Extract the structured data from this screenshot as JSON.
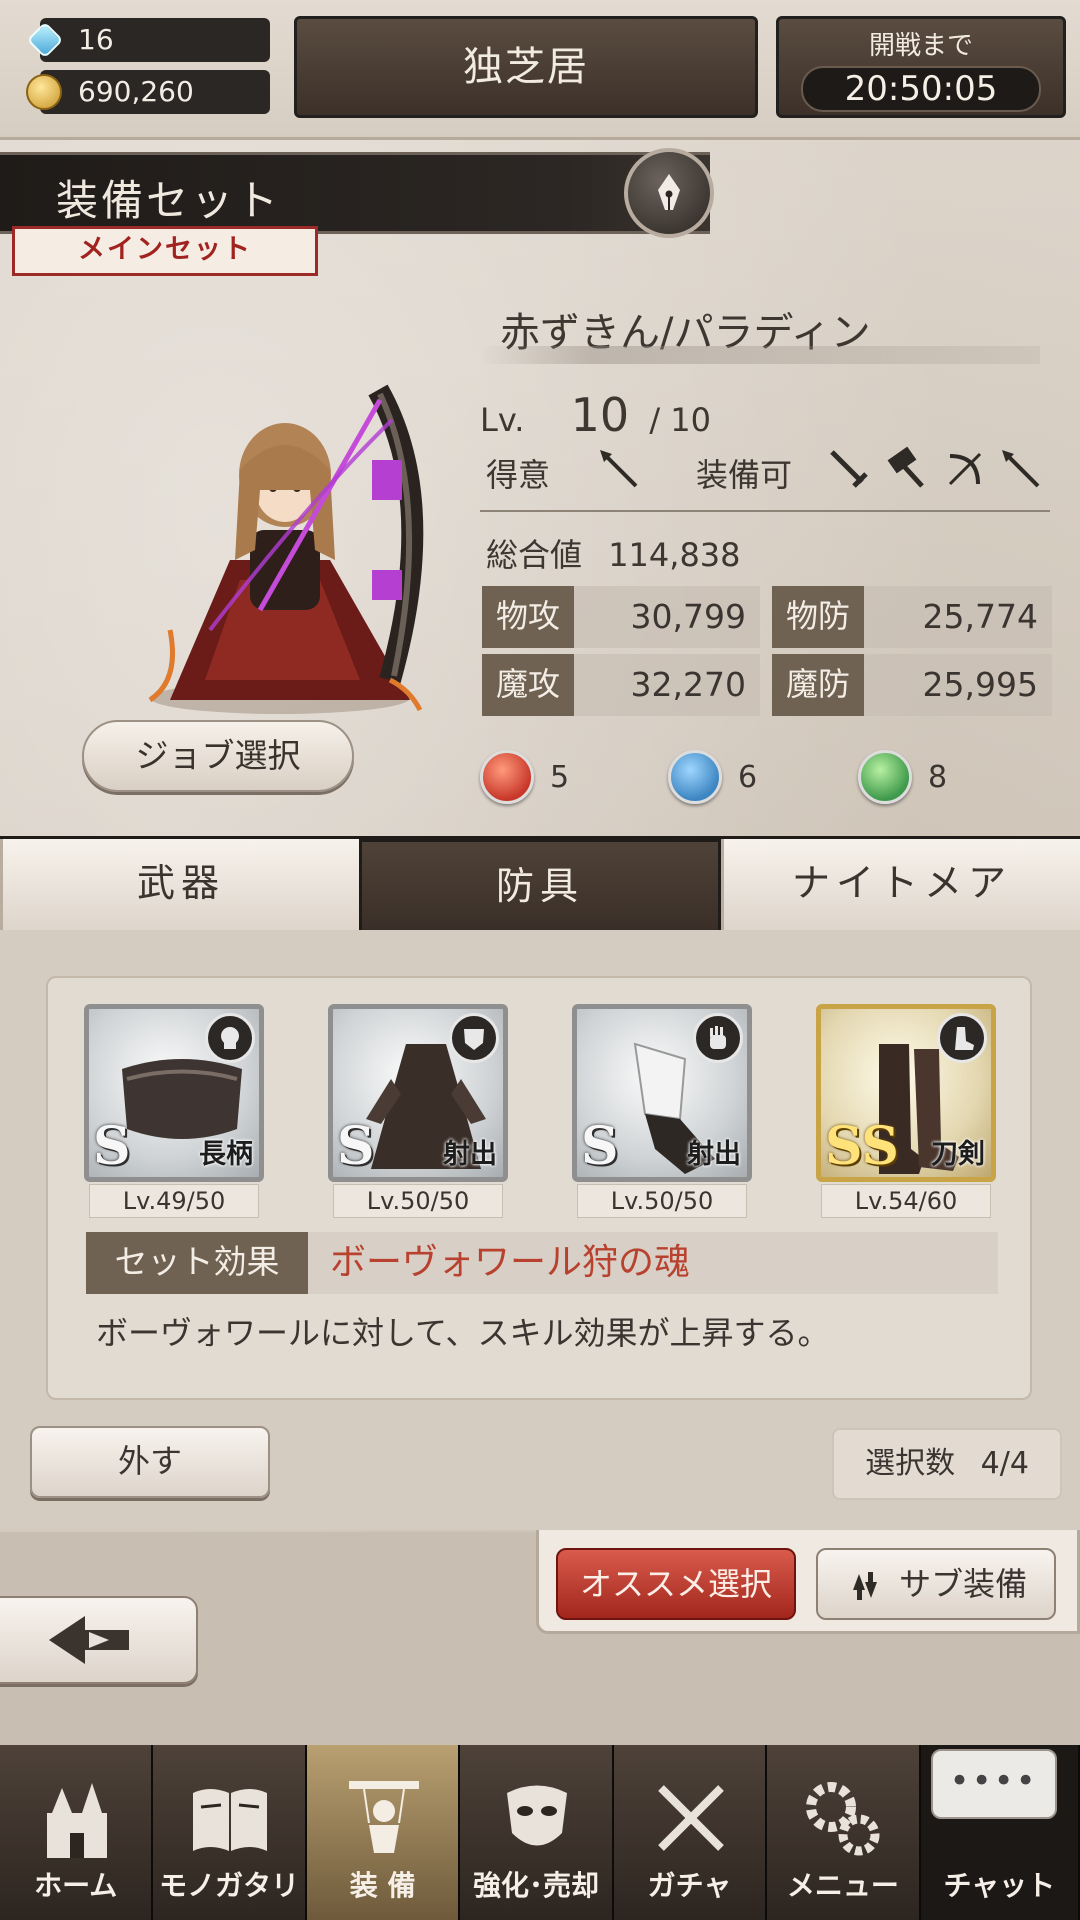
{
  "topbar": {
    "crystals": "16",
    "coins": "690,260",
    "title": "独芝居",
    "timer_label": "開戦まで",
    "timer_value": "20:50:05"
  },
  "equip_set": {
    "title": "装備セット",
    "ribbon": "メインセット"
  },
  "character": {
    "job_name": "赤ずきん/パラディン",
    "level_label": "Lv.",
    "level": "10",
    "level_max": "/ 10",
    "specialty_label": "得意",
    "equippable_label": "装備可",
    "total_label": "総合値",
    "total_value": "114,838",
    "stats": [
      {
        "label": "物攻",
        "value": "30,799"
      },
      {
        "label": "物防",
        "value": "25,774"
      },
      {
        "label": "魔攻",
        "value": "32,270"
      },
      {
        "label": "魔防",
        "value": "25,995"
      }
    ],
    "elements": [
      {
        "name": "fire",
        "count": "5",
        "color": "#c8382a"
      },
      {
        "name": "water",
        "count": "6",
        "color": "#3d86c2"
      },
      {
        "name": "wind",
        "count": "8",
        "color": "#3f9a4b"
      }
    ],
    "job_select_label": "ジョブ選択"
  },
  "tabs": [
    {
      "label": "武器",
      "active": false
    },
    {
      "label": "防具",
      "active": true
    },
    {
      "label": "ナイトメア",
      "active": false
    }
  ],
  "slots": [
    {
      "rank": "S",
      "type": "長柄",
      "level": "Lv.49/50",
      "badge_icon": "head-icon"
    },
    {
      "rank": "S",
      "type": "射出",
      "level": "Lv.50/50",
      "badge_icon": "body-icon"
    },
    {
      "rank": "S",
      "type": "射出",
      "level": "Lv.50/50",
      "badge_icon": "hand-icon"
    },
    {
      "rank": "SS",
      "type": "刀剣",
      "level": "Lv.54/60",
      "badge_icon": "foot-icon"
    }
  ],
  "set_effect": {
    "label": "セット効果",
    "name": "ボーヴォワール狩の魂",
    "description": "ボーヴォワールに対して、スキル効果が上昇する。"
  },
  "actions": {
    "remove_label": "外す",
    "count_label": "選択数",
    "count_value": "4/4",
    "recommend_label": "オススメ選択",
    "sub_label": "サブ装備"
  },
  "nav": [
    {
      "label": "ホーム",
      "icon": "castle-icon",
      "active": false
    },
    {
      "label": "モノガタリ",
      "icon": "book-icon",
      "active": false
    },
    {
      "label": "装 備",
      "icon": "puppet-icon",
      "active": true
    },
    {
      "label": "強化･売却",
      "icon": "mask-icon",
      "active": false
    },
    {
      "label": "ガチャ",
      "icon": "swords-icon",
      "active": false
    },
    {
      "label": "メニュー",
      "icon": "gears-icon",
      "active": false
    },
    {
      "label": "チャット",
      "icon": "chat-icon",
      "active": false
    }
  ]
}
